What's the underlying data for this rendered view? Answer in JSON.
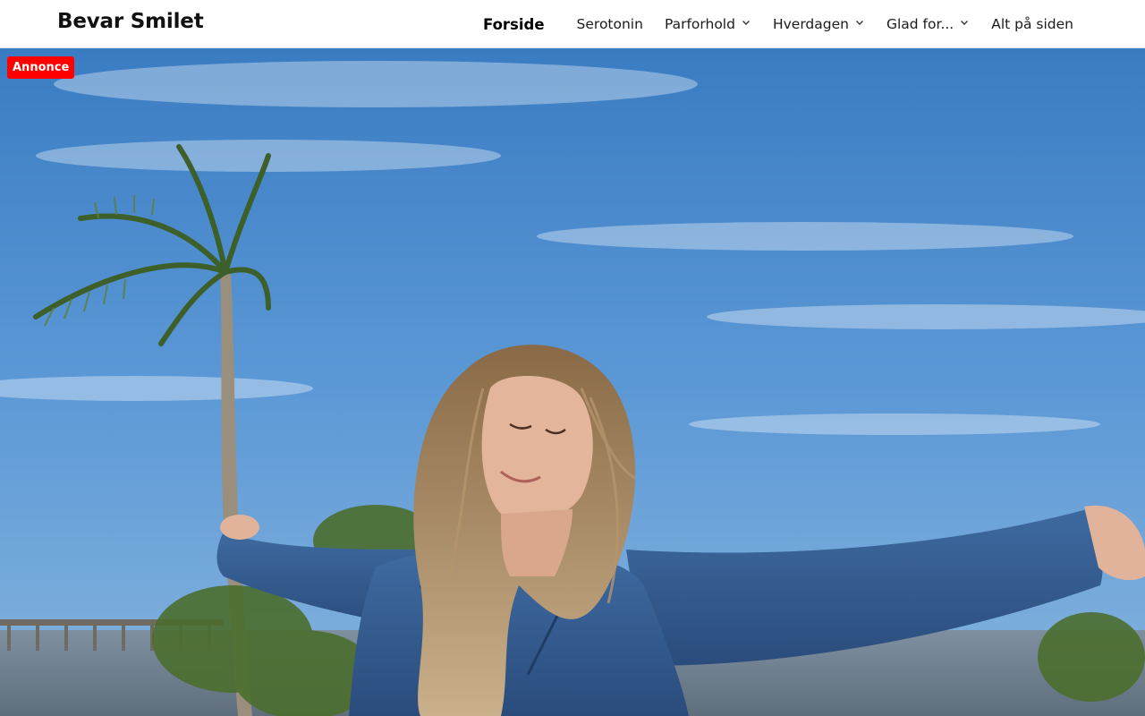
{
  "site": {
    "title": "Bevar Smilet"
  },
  "nav": {
    "items": [
      {
        "label": "Forside",
        "active": true,
        "has_submenu": false
      },
      {
        "label": "Serotonin",
        "active": false,
        "has_submenu": false
      },
      {
        "label": "Parforhold",
        "active": false,
        "has_submenu": true
      },
      {
        "label": "Hverdagen",
        "active": false,
        "has_submenu": true
      },
      {
        "label": "Glad for...",
        "active": false,
        "has_submenu": true
      },
      {
        "label": "Alt på siden",
        "active": false,
        "has_submenu": false
      }
    ]
  },
  "ad_badge": {
    "label": "Annonce",
    "color": "#ff0000"
  },
  "hero": {
    "icon": "hero-photo-woman-arms-outstretched"
  },
  "colors": {
    "header_bg": "#ffffff",
    "text": "#111111",
    "sky": "#4b8cd0"
  }
}
